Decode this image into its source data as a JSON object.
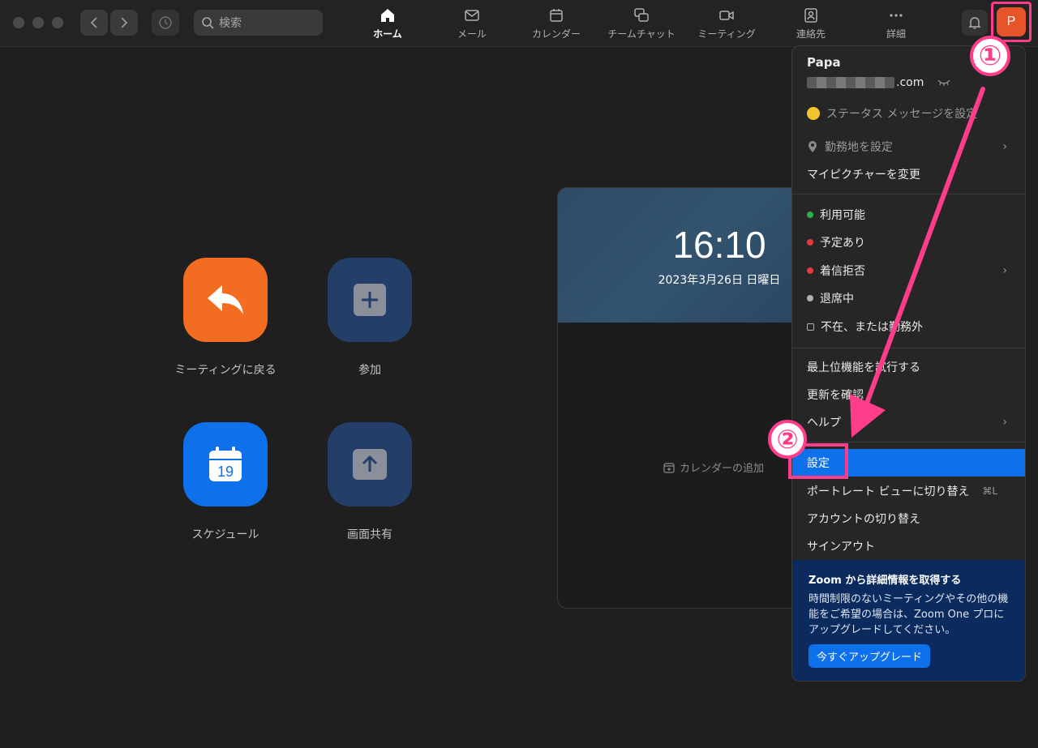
{
  "titlebar": {
    "search_placeholder": "検索",
    "tabs": [
      {
        "label": "ホーム",
        "icon": "home-icon"
      },
      {
        "label": "メール",
        "icon": "mail-icon"
      },
      {
        "label": "カレンダー",
        "icon": "calendar-icon"
      },
      {
        "label": "チームチャット",
        "icon": "chat-icon"
      },
      {
        "label": "ミーティング",
        "icon": "video-icon"
      },
      {
        "label": "連絡先",
        "icon": "contacts-icon"
      },
      {
        "label": "詳細",
        "icon": "more-icon"
      }
    ],
    "avatar_initial": "P"
  },
  "home": {
    "actions": [
      {
        "label": "ミーティングに戻る",
        "icon": "rejoin-arrow-icon",
        "color": "#f26d21"
      },
      {
        "label": "参加",
        "icon": "plus-icon",
        "color": "#243e6a"
      },
      {
        "label": "スケジュール",
        "icon": "calendar-19-icon",
        "color": "#0e71eb",
        "day": "19"
      },
      {
        "label": "画面共有",
        "icon": "share-up-icon",
        "color": "#243e6a"
      }
    ]
  },
  "calendar_panel": {
    "time": "16:10",
    "date": "2023年3月26日 日曜日",
    "add_calendar": "カレンダーの追加"
  },
  "menu": {
    "user_name": "Papa",
    "email_suffix": ".com",
    "status_message": "ステータス メッセージを設定",
    "work_location": "勤務地を設定",
    "change_picture": "マイピクチャーを変更",
    "statuses": [
      {
        "label": "利用可能",
        "color": "#2ab24a"
      },
      {
        "label": "予定あり",
        "color": "#e0393e"
      },
      {
        "label": "着信拒否",
        "color": "#e0393e"
      },
      {
        "label": "退席中",
        "color": "#b0b0b0"
      },
      {
        "label": "不在、または勤務外",
        "color": "#b0b0b0"
      }
    ],
    "try_top": "最上位機能を試行する",
    "check_updates": "更新を確認",
    "help": "ヘルプ",
    "settings": "設定",
    "portrait_view": "ポートレート ビューに切り替え",
    "portrait_shortcut": "⌘L",
    "switch_account": "アカウントの切り替え",
    "sign_out": "サインアウト",
    "promo": {
      "title": "Zoom から詳細情報を取得する",
      "body": "時間制限のないミーティングやその他の機能をご希望の場合は、Zoom One プロにアップグレードしてください。",
      "button": "今すぐアップグレード"
    }
  },
  "annotations": {
    "step1": "①",
    "step2": "②",
    "accent": "#ff3d8b"
  }
}
